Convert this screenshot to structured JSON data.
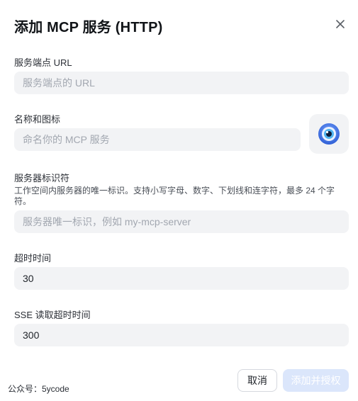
{
  "dialog": {
    "title": "添加 MCP 服务 (HTTP)"
  },
  "fields": {
    "url": {
      "label": "服务端点 URL",
      "placeholder": "服务端点的 URL",
      "value": ""
    },
    "name": {
      "label": "名称和图标",
      "placeholder": "命名你的 MCP 服务",
      "value": "",
      "icon": "eye-icon"
    },
    "identifier": {
      "label": "服务器标识符",
      "hint": "工作空间内服务器的唯一标识。支持小写字母、数字、下划线和连字符，最多 24 个字符。",
      "placeholder": "服务器唯一标识，例如 my-mcp-server",
      "value": ""
    },
    "timeout": {
      "label": "超时时间",
      "value": "30"
    },
    "sse_timeout": {
      "label": "SSE 读取超时时间",
      "value": "300"
    }
  },
  "footer": {
    "note": "公众号：5ycode",
    "cancel_label": "取消",
    "submit_label": "添加并授权"
  },
  "colors": {
    "input_bg": "#f2f3f5",
    "submit_disabled_bg": "#dbe6fb",
    "icon_blue": "#3d6fe0"
  }
}
